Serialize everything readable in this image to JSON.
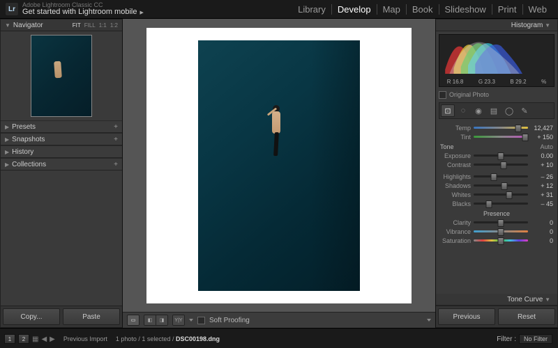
{
  "title": {
    "app": "Adobe Lightroom Classic CC",
    "sub": "Get started with Lightroom mobile"
  },
  "modules": {
    "items": [
      "Library",
      "Develop",
      "Map",
      "Book",
      "Slideshow",
      "Print",
      "Web"
    ],
    "active": "Develop"
  },
  "navigator": {
    "label": "Navigator",
    "zoom": [
      "FIT",
      "FILL",
      "1:1",
      "1:2"
    ],
    "zoom_active": "FIT"
  },
  "left_panels": {
    "presets": "Presets",
    "snapshots": "Snapshots",
    "history": "History",
    "collections": "Collections"
  },
  "left_buttons": {
    "copy": "Copy...",
    "paste": "Paste"
  },
  "toolbar": {
    "soft_proof": "Soft Proofing"
  },
  "right": {
    "histogram": "Histogram",
    "rgb": {
      "r": "R  16.8",
      "g": "G  23.3",
      "b": "B  29.2",
      "pct": "%"
    },
    "original": "Original Photo",
    "wb": {
      "temp_lbl": "Temp",
      "temp_val": "12,427",
      "tint_lbl": "Tint",
      "tint_val": "+ 150"
    },
    "tone": {
      "head": "Tone",
      "auto": "Auto",
      "exposure_lbl": "Exposure",
      "exposure_val": "0.00",
      "contrast_lbl": "Contrast",
      "contrast_val": "+ 10",
      "highlights_lbl": "Highlights",
      "highlights_val": "– 26",
      "shadows_lbl": "Shadows",
      "shadows_val": "+ 12",
      "whites_lbl": "Whites",
      "whites_val": "+ 31",
      "blacks_lbl": "Blacks",
      "blacks_val": "– 45"
    },
    "presence": {
      "head": "Presence",
      "clarity_lbl": "Clarity",
      "clarity_val": "0",
      "vibrance_lbl": "Vibrance",
      "vibrance_val": "0",
      "saturation_lbl": "Saturation",
      "saturation_val": "0"
    },
    "tone_curve": "Tone Curve",
    "buttons": {
      "prev": "Previous",
      "reset": "Reset"
    }
  },
  "filmstrip": {
    "pages": [
      "1",
      "2"
    ],
    "source": "Previous Import",
    "count": "1 photo / 1 selected /",
    "file": "DSC00198.dng",
    "filter_lbl": "Filter :",
    "filter_val": "No Filter"
  }
}
